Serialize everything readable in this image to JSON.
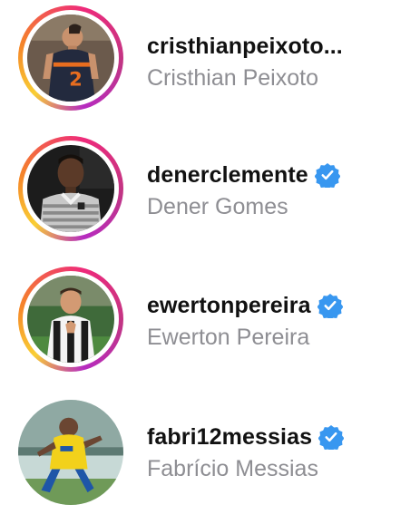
{
  "accounts": [
    {
      "username": "cristhianpeixoto...",
      "full_name": "Cristhian Peixoto",
      "verified": false,
      "has_story": true,
      "avatar_icon": "profile-photo"
    },
    {
      "username": "denerclemente",
      "full_name": "Dener Gomes",
      "verified": true,
      "has_story": true,
      "avatar_icon": "profile-photo"
    },
    {
      "username": "ewertonpereira",
      "full_name": "Ewerton Pereira",
      "verified": true,
      "has_story": true,
      "avatar_icon": "profile-photo"
    },
    {
      "username": "fabri12messias",
      "full_name": "Fabrício Messias",
      "verified": true,
      "has_story": false,
      "avatar_icon": "profile-photo"
    }
  ],
  "colors": {
    "username": "#111111",
    "full_name": "#8e8e93",
    "verified_badge": "#3897f0",
    "story_ring_start": "#f9ce34",
    "story_ring_mid": "#ee2a7b",
    "story_ring_end": "#b62bc0"
  }
}
